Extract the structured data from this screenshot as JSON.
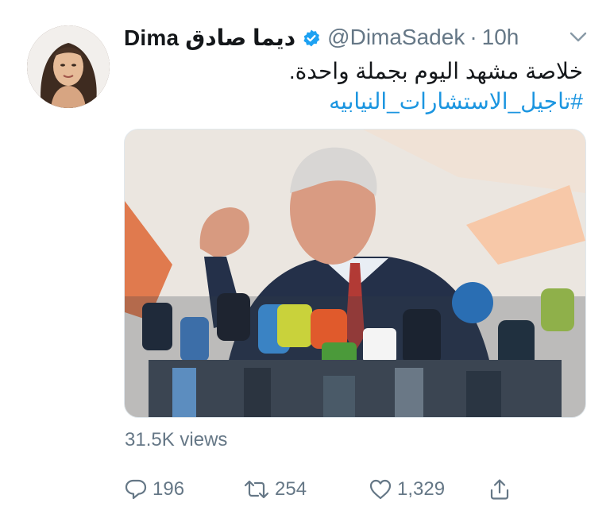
{
  "tweet": {
    "author": {
      "display_name": "Dima ديما صادق",
      "handle": "@DimaSadek",
      "time": "10h",
      "separator": "·",
      "verified": true
    },
    "text": "خلاصة مشهد اليوم بجملة واحدة.",
    "hashtag": "#تاجيل_الاستشارات_النيابيه",
    "views": "31.5K views",
    "actions": {
      "reply_count": "196",
      "retweet_count": "254",
      "like_count": "1,329"
    }
  },
  "colors": {
    "link": "#1b95e0",
    "muted": "#657786",
    "verified": "#1da1f2",
    "text": "#14171a"
  },
  "icons": {
    "verified": "verified-badge-icon",
    "menu": "chevron-down-icon",
    "reply": "reply-icon",
    "retweet": "retweet-icon",
    "like": "heart-icon",
    "share": "share-icon"
  }
}
